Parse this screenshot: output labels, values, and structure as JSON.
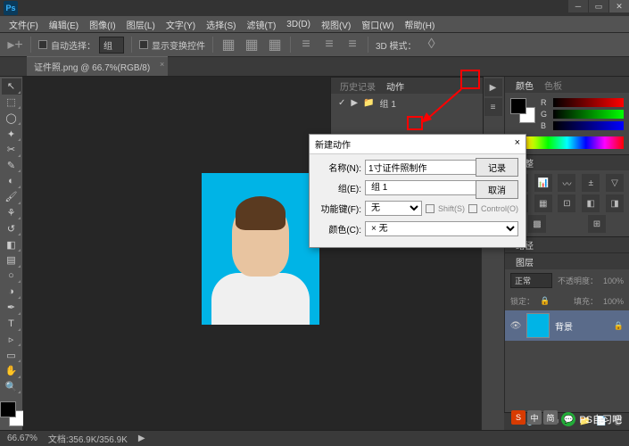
{
  "app": {
    "logo": "Ps"
  },
  "menu": [
    "文件(F)",
    "编辑(E)",
    "图像(I)",
    "图层(L)",
    "文字(Y)",
    "选择(S)",
    "滤镜(T)",
    "3D(D)",
    "视图(V)",
    "窗口(W)",
    "帮助(H)"
  ],
  "options": {
    "auto_select_label": "自动选择：",
    "auto_select_value": "组",
    "show_transform_label": "显示变换控件",
    "mode3d_label": "3D 模式："
  },
  "doc_tab": {
    "label": "证件照.png @ 66.7%(RGB/8)"
  },
  "history_panel": {
    "tab1": "历史记录",
    "tab2": "动作",
    "set_label": "组 1"
  },
  "dialog": {
    "title": "新建动作",
    "name_label": "名称(N):",
    "name_value": "1寸证件照制作",
    "set_label": "组(E):",
    "set_value": "组 1",
    "fkey_label": "功能键(F):",
    "fkey_value": "无",
    "shift_label": "Shift(S)",
    "ctrl_label": "Control(O)",
    "color_label": "颜色(C):",
    "color_value": "× 无",
    "record_btn": "记录",
    "cancel_btn": "取消"
  },
  "color_panel": {
    "tab1": "颜色",
    "tab2": "色板",
    "channels": [
      "R",
      "G",
      "B"
    ]
  },
  "layers_panel": {
    "tab": "图层",
    "blend_mode": "正常",
    "opacity_label": "不透明度：",
    "opacity_value": "100%",
    "lock_label": "锁定：",
    "fill_label": "填充：",
    "fill_value": "100%",
    "layer_name": "背景"
  },
  "adjust_panel": {
    "tab1": "调整"
  },
  "paths_panel": {
    "tab": "路径"
  },
  "status": {
    "zoom": "66.67%",
    "doc_info": "文档:356.9K/356.9K"
  },
  "watermark": {
    "text": "PS自习吧"
  },
  "ime": [
    "S",
    "中",
    "简"
  ]
}
